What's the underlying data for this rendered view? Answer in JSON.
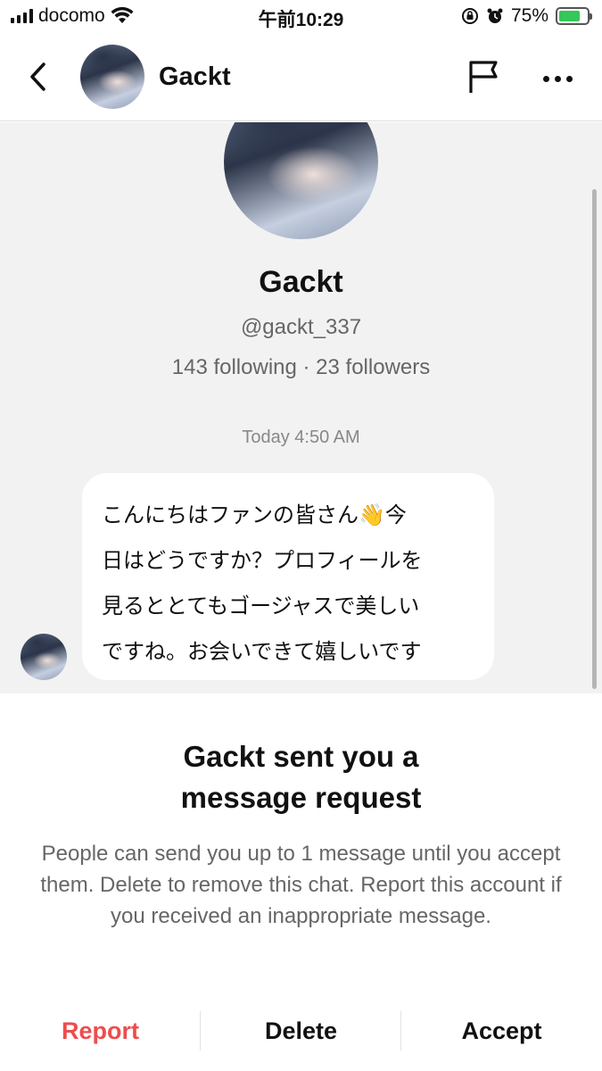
{
  "status_bar": {
    "carrier": "docomo",
    "time": "午前10:29",
    "battery_percent": "75%",
    "battery_level": 0.75
  },
  "header": {
    "name": "Gackt",
    "icons": [
      "chevron-left-icon",
      "flag-icon",
      "more-icon"
    ]
  },
  "profile": {
    "name": "Gackt",
    "handle": "@gackt_337",
    "stats": "143 following · 23 followers"
  },
  "chat": {
    "timestamp": "Today 4:50 AM",
    "message_lines": [
      "こんにちはファンの皆さん👋今",
      "日はどうですか？プロフィールを",
      "見るととてもゴージャスで美しい",
      "ですね。お会いできて嬉しいです"
    ]
  },
  "request": {
    "title_line1": "Gackt sent you a",
    "title_line2": "message request",
    "body": "People can send you up to 1 message until you accept them. Delete to remove this chat. Report this account if you received an inappropriate message.",
    "report_label": "Report",
    "delete_label": "Delete",
    "accept_label": "Accept"
  },
  "colors": {
    "report": "#ee4d4d",
    "chat_background": "#f2f2f2",
    "battery_fill": "#34c759"
  }
}
